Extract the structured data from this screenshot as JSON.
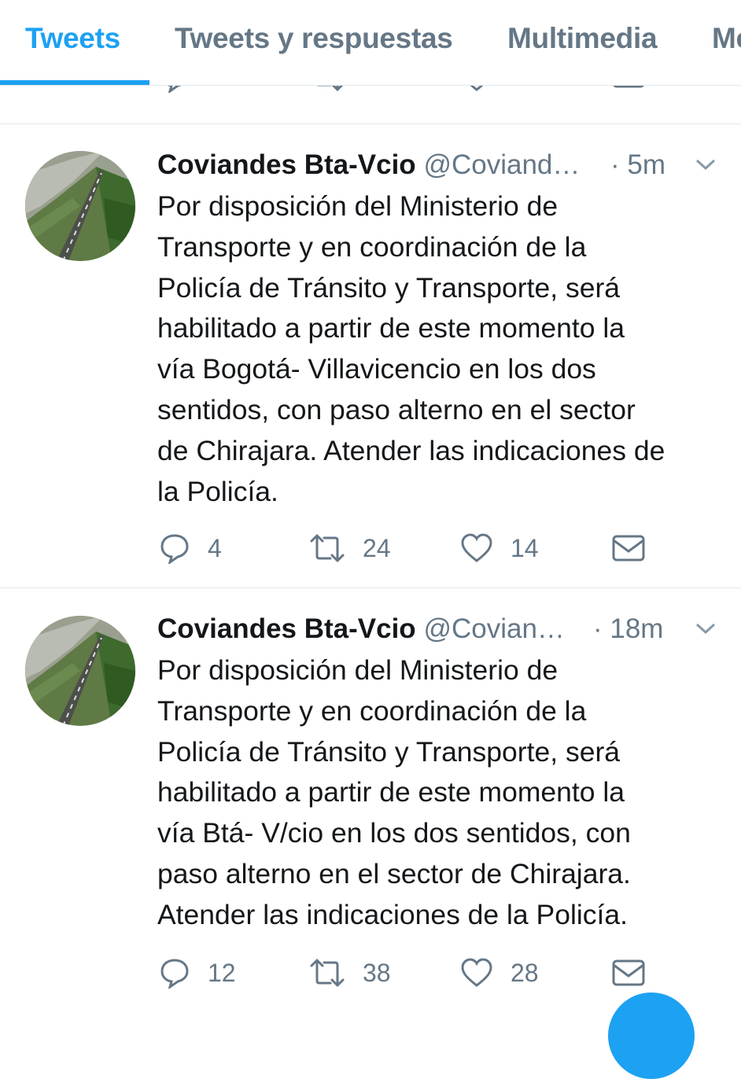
{
  "tabs": [
    {
      "label": "Tweets",
      "active": true
    },
    {
      "label": "Tweets y respuestas",
      "active": false
    },
    {
      "label": "Multimedia",
      "active": false
    },
    {
      "label": "Me",
      "active": false
    }
  ],
  "accent_color": "#1da1f2",
  "tweets": [
    {
      "name": "Coviandes Bta-Vcio",
      "handle": "@Coviand…",
      "time": "· 5m",
      "text_lines": [
        "Por disposición del Ministerio de",
        "Transporte y en coordinación de la",
        "Policía de Tránsito y Transporte, será",
        "habilitado a partir de este momento la",
        "vía Bogotá- Villavicencio en los dos",
        "sentidos, con paso alterno en el sector",
        "de Chirajara. Atender las indicaciones de",
        "la Policía."
      ],
      "replies": "4",
      "retweets": "24",
      "likes": "14"
    },
    {
      "name": "Coviandes Bta-Vcio",
      "handle": "@Covian…",
      "time": "· 18m",
      "text_lines": [
        "Por disposición del Ministerio de",
        "Transporte y en coordinación de la",
        "Policía de Tránsito y Transporte, será",
        "habilitado a partir de este momento la",
        "vía Btá- V/cio en los dos sentidos, con",
        "paso alterno en el sector de Chirajara.",
        "Atender las indicaciones de la Policía."
      ],
      "replies": "12",
      "retweets": "38",
      "likes": "28"
    }
  ],
  "icons": {
    "reply": "reply-icon",
    "retweet": "retweet-icon",
    "like": "heart-icon",
    "message": "envelope-icon",
    "menu": "chevron-down-icon"
  }
}
